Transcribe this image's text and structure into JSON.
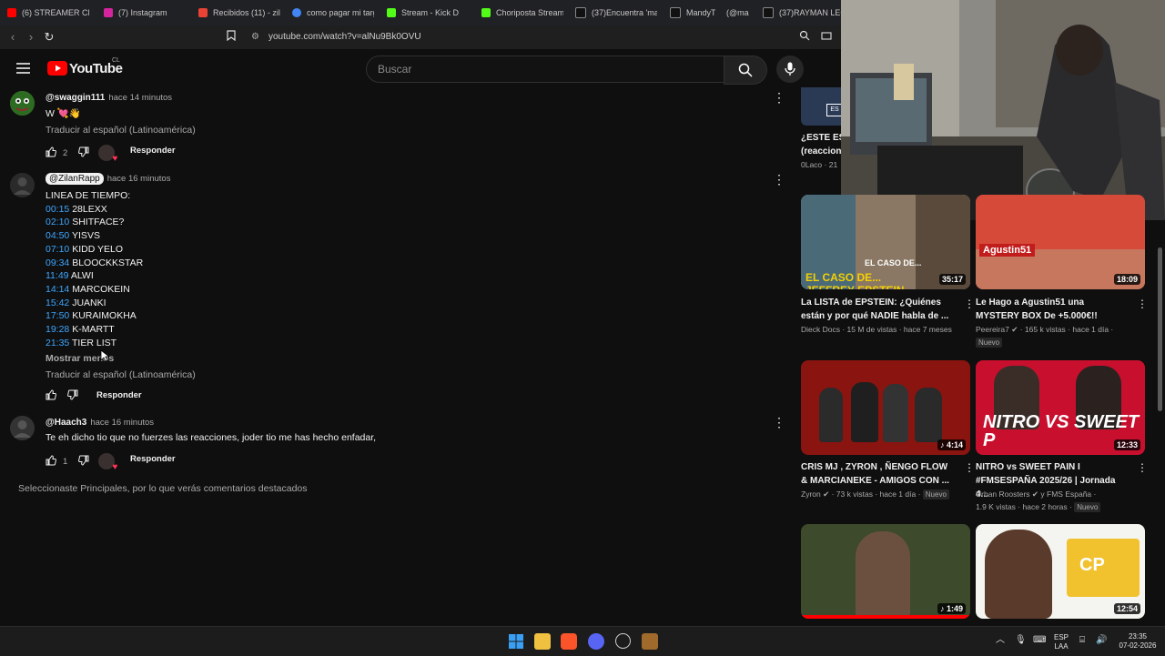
{
  "browser": {
    "tabs": [
      {
        "label": "(6) STREAMER CHIL",
        "color": "#ff0000"
      },
      {
        "label": "(7) Instagram",
        "color": "#d6249f"
      },
      {
        "label": "Recibidos (11) - zila",
        "color": "#ea4335"
      },
      {
        "label": "como pagar mi targ",
        "color": "#4285f4"
      },
      {
        "label": "Stream - Kick D",
        "color": "#53fc18"
      },
      {
        "label": "Choriposta Stream",
        "color": "#53fc18"
      },
      {
        "label": "(37)Encuentra 'mara",
        "color": "#ffffff"
      },
      {
        "label": "MandyTC",
        "color": "#ffffff"
      },
      {
        "label": "(@ma",
        "color": "#ffffff"
      },
      {
        "label": "(37)RAYMAN LEGE",
        "color": "#ffffff"
      }
    ],
    "url": "youtube.com/watch?v=alNu9Bk0OVU"
  },
  "youtube": {
    "logo_text": "YouTube",
    "country": "CL",
    "search_placeholder": "Buscar"
  },
  "comments": [
    {
      "author": "@swaggin111",
      "time": "hace 14 minutos",
      "text": "W 💘👋",
      "translate": "Traducir al español (Latinoamérica)",
      "likes": "2",
      "reply": "Responder"
    },
    {
      "author": "@ZilanRapp",
      "time": "hace 16 minutos",
      "heading": "LINEA DE TIEMPO:",
      "timeline": [
        {
          "ts": "00:15",
          "name": "28LEXX"
        },
        {
          "ts": "02:10",
          "name": "SHITFACE?"
        },
        {
          "ts": "04:50",
          "name": "YISVS"
        },
        {
          "ts": "07:10",
          "name": "KIDD YELO"
        },
        {
          "ts": "09:34",
          "name": "BLOOCKKSTAR"
        },
        {
          "ts": "11:49",
          "name": "ALWI"
        },
        {
          "ts": "14:14",
          "name": "MARCOKEIN"
        },
        {
          "ts": "15:42",
          "name": "JUANKI"
        },
        {
          "ts": "17:50",
          "name": "KURAIMOKHA"
        },
        {
          "ts": "19:28",
          "name": "K-MARTT"
        },
        {
          "ts": "21:35",
          "name": "TIER LIST"
        }
      ],
      "show_less": "Mostrar menos",
      "translate": "Traducir al español (Latinoamérica)",
      "reply": "Responder"
    },
    {
      "author": "@Haach3",
      "time": "hace 16 minutos",
      "text": "Te eh dicho tio que no fuerzes las reacciones, joder tio me has hecho enfadar,",
      "likes": "1",
      "reply": "Responder"
    }
  ],
  "footer_note": "Seleccionaste Principales, por lo que verás comentarios destacados",
  "sidebar": {
    "partial": {
      "title1": "¿ESTE ES",
      "title2": "(reaccion",
      "meta": "0Laco · 21"
    },
    "videos": [
      {
        "title": "La LISTA de EPSTEIN: ¿Quiénes están y por qué NADIE habla de ...",
        "channel": "Dieck Docs",
        "meta": "15 M de vistas · hace 7 meses",
        "duration": "35:17",
        "thumb_text": "EL CASO DE... JEFFREY EPSTEIN",
        "verified": false,
        "badge": ""
      },
      {
        "title": "Le Hago a Agustin51 una MYSTERY BOX De +5.000€!!",
        "channel": "Peereira7",
        "meta": "165 k vistas · hace 1 día ·",
        "duration": "18:09",
        "thumb_text": "Agustin51",
        "verified": true,
        "badge": "Nuevo"
      },
      {
        "title": "CRIS MJ , ZYRON , ÑENGO FLOW & MARCIANEKE - AMIGOS CON ...",
        "channel": "Zyron",
        "meta": "73 k vistas · hace 1 día",
        "duration": "4:14",
        "thumb_text": "",
        "verified": true,
        "badge": "Nuevo"
      },
      {
        "title": "NITRO vs SWEET PAIN I #FMSESPAÑA 2025/26 | Jornada 4...",
        "channel": "Urban Roosters",
        "meta": "y FMS España ·",
        "meta2": "1.9 K vistas · hace 2 horas ·",
        "duration": "12:33",
        "thumb_text": "NITRO VS SWEET P",
        "verified": true,
        "badge": "Nuevo"
      },
      {
        "title": "",
        "channel": "",
        "meta": "",
        "duration": "1:49",
        "thumb_text": "",
        "verified": false,
        "badge": ""
      },
      {
        "title": "",
        "channel": "",
        "meta": "",
        "duration": "12:54",
        "thumb_text": "CP",
        "verified": false,
        "badge": ""
      }
    ]
  },
  "taskbar": {
    "lang1": "ESP",
    "lang2": "LAA",
    "time": "23:35",
    "date": "07-02-2026"
  }
}
